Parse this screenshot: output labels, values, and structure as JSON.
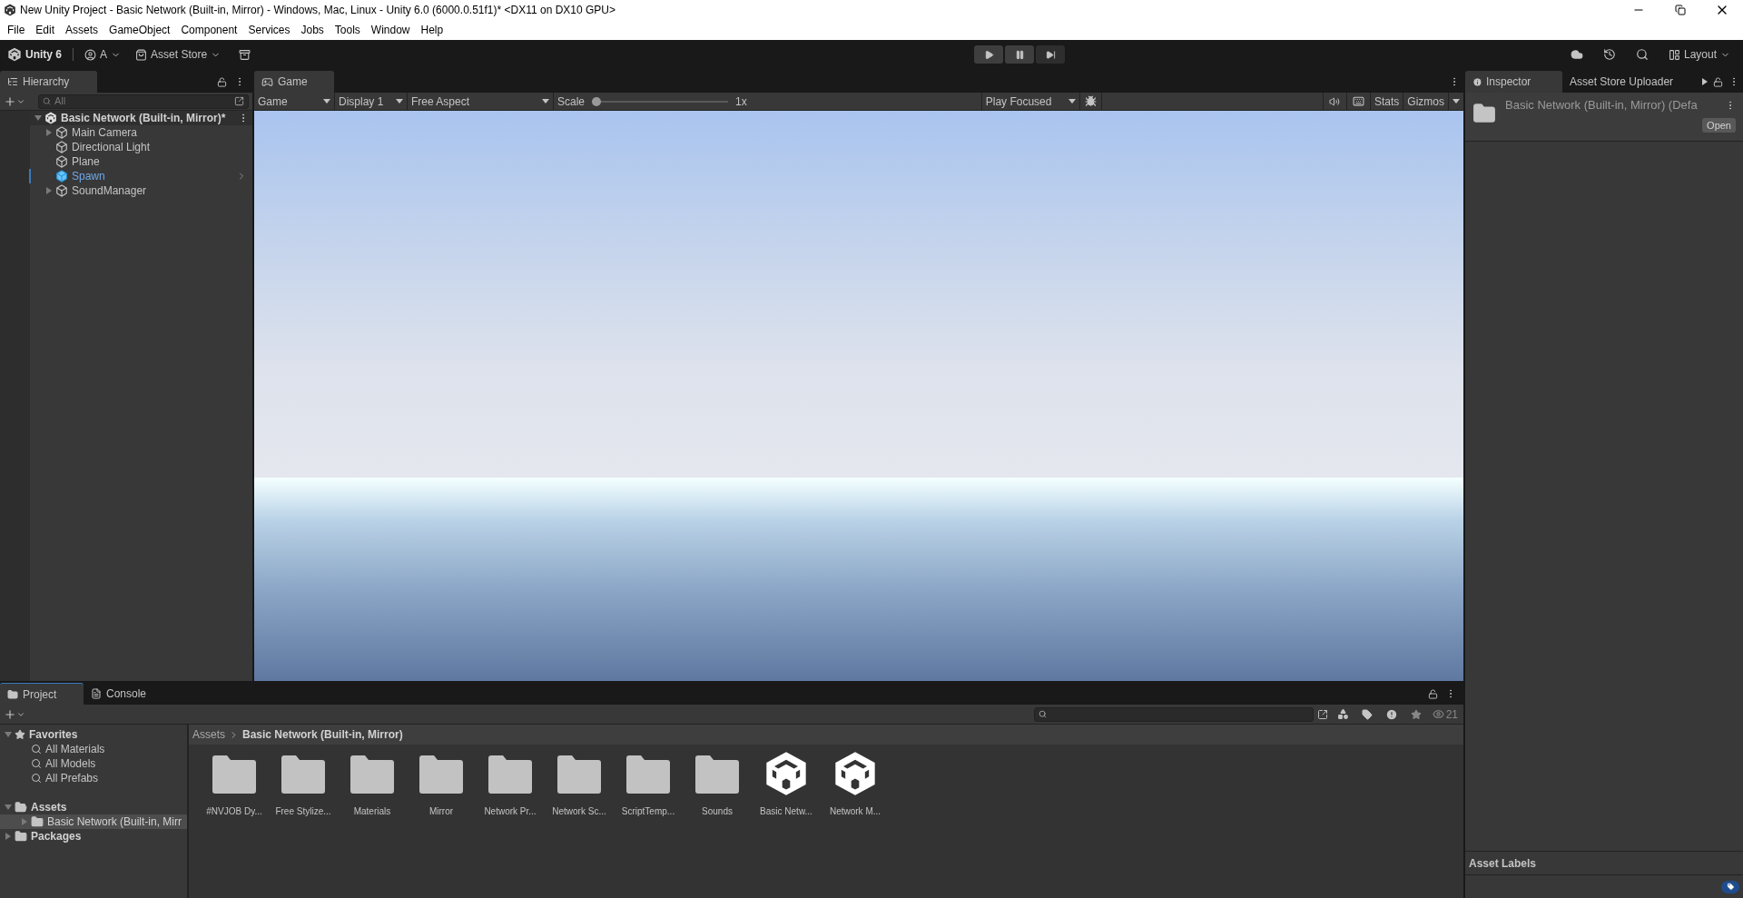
{
  "window": {
    "title": "New Unity Project - Basic Network (Built-in, Mirror) - Windows, Mac, Linux - Unity 6.0 (6000.0.51f1)* <DX11 on DX10 GPU>"
  },
  "menu": [
    "File",
    "Edit",
    "Assets",
    "GameObject",
    "Component",
    "Services",
    "Jobs",
    "Tools",
    "Window",
    "Help"
  ],
  "toolbar": {
    "product": "Unity 6",
    "account": "A",
    "store": "Asset Store",
    "layout": "Layout"
  },
  "hierarchy": {
    "tab": "Hierarchy",
    "search_placeholder": "All",
    "scene": "Basic Network (Built-in, Mirror)*",
    "items": [
      {
        "name": "Main Camera",
        "expandable": true,
        "selected": false
      },
      {
        "name": "Directional Light",
        "expandable": false,
        "selected": false
      },
      {
        "name": "Plane",
        "expandable": false,
        "selected": false
      },
      {
        "name": "Spawn",
        "expandable": false,
        "selected": true
      },
      {
        "name": "SoundManager",
        "expandable": true,
        "selected": false
      }
    ]
  },
  "game": {
    "tab": "Game",
    "view_mode": "Game",
    "display": "Display 1",
    "aspect": "Free Aspect",
    "scale_label": "Scale",
    "scale": {
      "level": 0
    },
    "scale_value": "1x",
    "play_mode": "Play Focused",
    "stats": "Stats",
    "gizmos": "Gizmos"
  },
  "inspector": {
    "tabs": [
      {
        "label": "Inspector",
        "selected": true
      },
      {
        "label": "Asset Store Uploader",
        "selected": false
      }
    ],
    "asset_name": "Basic Network (Built-in, Mirror) (Defa",
    "open_button": "Open",
    "labels_header": "Asset Labels"
  },
  "project": {
    "tabs": [
      {
        "label": "Project",
        "selected": true
      },
      {
        "label": "Console",
        "selected": false
      }
    ],
    "favorites": {
      "label": "Favorites",
      "items": [
        "All Materials",
        "All Models",
        "All Prefabs"
      ]
    },
    "tree": [
      {
        "name": "Assets",
        "expanded": true,
        "selected": false,
        "children": [
          {
            "name": "Basic Network (Built-in, Mirr",
            "expanded": false,
            "selected": true
          }
        ]
      },
      {
        "name": "Packages",
        "expanded": false,
        "selected": false
      }
    ],
    "breadcrumb": [
      "Assets",
      "Basic Network (Built-in, Mirror)"
    ],
    "visible_count": "21",
    "assets": [
      {
        "name": "#NVJOB Dy...",
        "kind": "folder"
      },
      {
        "name": "Free Stylize...",
        "kind": "folder"
      },
      {
        "name": "Materials",
        "kind": "folder"
      },
      {
        "name": "Mirror",
        "kind": "folder"
      },
      {
        "name": "Network Pr...",
        "kind": "folder"
      },
      {
        "name": "Network Sc...",
        "kind": "folder"
      },
      {
        "name": "ScriptTemp...",
        "kind": "folder"
      },
      {
        "name": "Sounds",
        "kind": "folder"
      },
      {
        "name": "Basic Netw...",
        "kind": "scene"
      },
      {
        "name": "Network M...",
        "kind": "scene"
      }
    ]
  }
}
